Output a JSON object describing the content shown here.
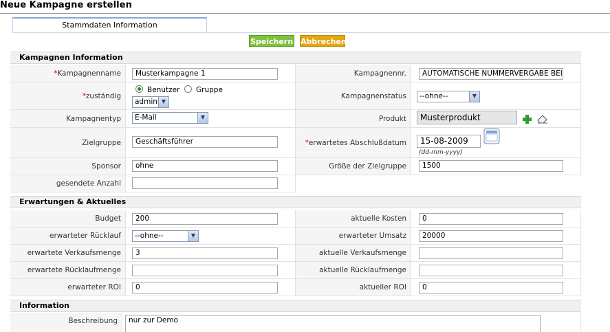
{
  "page": {
    "title": "Neue Kampagne erstellen"
  },
  "tab": {
    "label": "Stammdaten Information"
  },
  "actions": {
    "save": "Speichern",
    "cancel": "Abbrechen"
  },
  "sections": {
    "info": "Kampagnen Information",
    "expect": "Erwartungen & Aktuelles",
    "information": "Information"
  },
  "fields": {
    "kampagnenname": {
      "label": "Kampagnenname",
      "required": "*",
      "value": "Musterkampagne 1"
    },
    "kampagnennr": {
      "label": "Kampagnennr.",
      "value": "AUTOMATISCHE NUMMERVERGABE BEIM"
    },
    "zustaendig": {
      "label": "zuständig",
      "required": "*",
      "radio_user": "Benutzer",
      "radio_group": "Gruppe",
      "selected": "admin"
    },
    "kampagnenstatus": {
      "label": "Kampagnenstatus",
      "selected": "--ohne--"
    },
    "kampagnentyp": {
      "label": "Kampagnentyp",
      "selected": "E-Mail"
    },
    "produkt": {
      "label": "Produkt",
      "value": "Musterprodukt"
    },
    "zielgruppe": {
      "label": "Zielgruppe",
      "value": "Geschäftsführer"
    },
    "abschlussdatum": {
      "label": "erwartetes Abschlußdatum",
      "required": "*",
      "value": "15-08-2009",
      "format": "(dd-mm-yyyy)"
    },
    "sponsor": {
      "label": "Sponsor",
      "value": "ohne"
    },
    "zielgruppe_groesse": {
      "label": "Größe der Zielgruppe",
      "value": "1500"
    },
    "gesendete_anzahl": {
      "label": "gesendete Anzahl",
      "value": ""
    },
    "budget": {
      "label": "Budget",
      "value": "200"
    },
    "aktuelle_kosten": {
      "label": "aktuelle Kosten",
      "value": "0"
    },
    "erwarteter_ruecklauf": {
      "label": "erwarteter Rücklauf",
      "selected": "--ohne--"
    },
    "erwarteter_umsatz": {
      "label": "erwarteter Umsatz",
      "value": "20000"
    },
    "erwartete_verkaufsmenge": {
      "label": "erwartete Verkaufsmenge",
      "value": "3"
    },
    "aktuelle_verkaufsmenge": {
      "label": "aktuelle Verkaufsmenge",
      "value": ""
    },
    "erwartete_ruecklaufmenge": {
      "label": "erwartete Rücklaufmenge",
      "value": ""
    },
    "aktuelle_ruecklaufmenge": {
      "label": "aktuelle Rücklaufmenge",
      "value": ""
    },
    "erwarteter_roi": {
      "label": "erwarteter ROI",
      "value": "0"
    },
    "aktueller_roi": {
      "label": "aktueller ROI",
      "value": "0"
    },
    "beschreibung": {
      "label": "Beschreibung",
      "value": "nur zur Demo"
    }
  },
  "colors": {
    "save_btn": "#7ec13d",
    "cancel_btn": "#e3a712",
    "required": "#dd0000",
    "radio_checked": "#1d8f24"
  },
  "icons": {
    "add": "plus-icon",
    "clear": "eraser-icon",
    "calendar": "calendar-icon"
  }
}
